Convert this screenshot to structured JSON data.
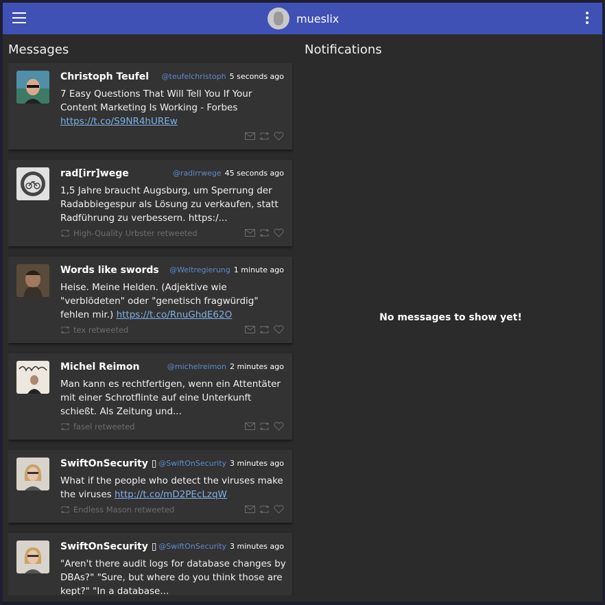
{
  "header": {
    "username": "mueslix",
    "menu_icon": "menu-icon",
    "more_icon": "more-vertical-icon"
  },
  "columns": {
    "messages_title": "Messages",
    "notifications_title": "Notifications",
    "notifications_empty": "No messages to show yet!"
  },
  "tweets": [
    {
      "name": "Christoph Teufel",
      "handle": "@teufelchristoph",
      "time": "5 seconds ago",
      "text": "7 Easy Questions That Will Tell You If Your Content Marketing Is Working - Forbes ",
      "link": "https://t.co/S9NR4hUREw",
      "retweeted_by": ""
    },
    {
      "name": "rad[irr]wege",
      "handle": "@radirrwege",
      "time": "45 seconds ago",
      "text": "1,5 Jahre braucht Augsburg, um Sperrung der Radabbiegespur als Lösung zu verkaufen, statt Radführung zu verbessern. https:/...",
      "link": "",
      "retweeted_by": "High-Quality Urbster retweeted"
    },
    {
      "name": "Words like swords",
      "handle": "@Weltregierung",
      "time": "1 minute ago",
      "text": "Heise. Meine Helden. (Adjektive wie \"verblödeten\" oder \"genetisch fragwürdig\" fehlen mir.) ",
      "link": "https://t.co/RnuGhdE62O",
      "retweeted_by": "tex retweeted"
    },
    {
      "name": "Michel Reimon",
      "handle": "@michelreimon",
      "time": "2 minutes ago",
      "text": "Man kann es rechtfertigen, wenn ein Attentäter mit einer Schrotflinte auf eine Unterkunft schießt. Als Zeitung und...",
      "link": "",
      "retweeted_by": "fasel retweeted"
    },
    {
      "name": "SwiftOnSecurity ▯",
      "handle": "@SwiftOnSecurity",
      "time": "3 minutes ago",
      "text": "What if the people who detect the viruses make the viruses ",
      "link": "http://t.co/mD2PEcLzqW",
      "retweeted_by": "Endless Mason retweeted"
    },
    {
      "name": "SwiftOnSecurity ▯",
      "handle": "@SwiftOnSecurity",
      "time": "3 minutes ago",
      "text": "\"Aren't there audit logs for database changes by DBAs?\" \"Sure, but where do you think those are kept?\" \"In a database...",
      "link": "",
      "retweeted_by": ""
    }
  ],
  "icons": {
    "message": "mail-icon",
    "retweet": "retweet-icon",
    "like": "heart-icon"
  },
  "colors": {
    "appbar": "#3f51b5",
    "background": "#2b2b2b",
    "card": "#333333",
    "handle": "#5c8bd0",
    "link": "#7fb1e8"
  }
}
